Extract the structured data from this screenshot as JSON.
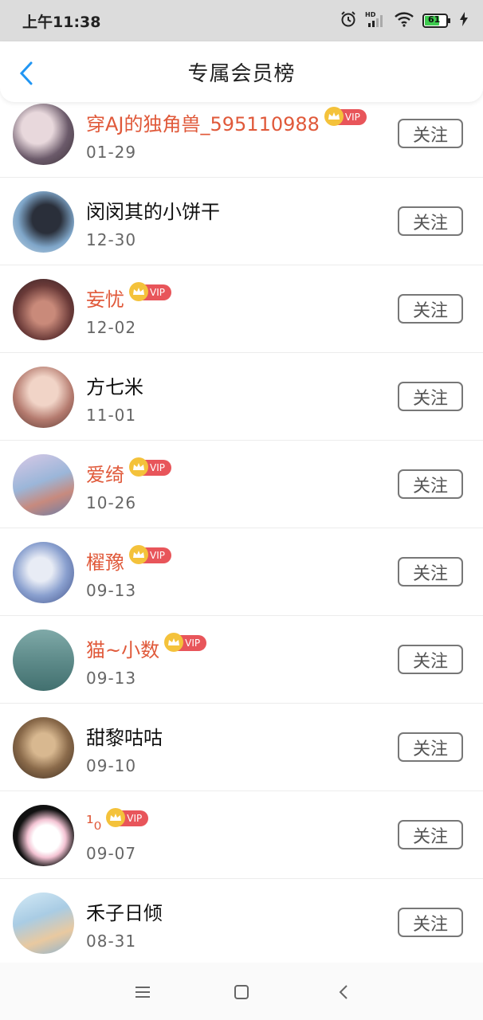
{
  "status_bar": {
    "time": "上午11:38",
    "battery": "61",
    "icons": [
      "alarm-icon",
      "signal-hd-icon",
      "wifi-icon",
      "battery-icon",
      "charging-icon"
    ]
  },
  "header": {
    "title": "专属会员榜",
    "back_icon": "chevron-left-icon"
  },
  "colors": {
    "accent": "#2196f3",
    "vip_name": "#e0593a",
    "vip_badge": "#e8555a",
    "crown": "#f4c23b"
  },
  "vip_label": "VIP",
  "follow_label": "关注",
  "members": [
    {
      "name": "穿AJ的独角兽_595110988",
      "date": "01-29",
      "vip": true
    },
    {
      "name": "闵闵其的小饼干",
      "date": "12-30",
      "vip": false
    },
    {
      "name": "妄忧",
      "date": "12-02",
      "vip": true
    },
    {
      "name": "方七米",
      "date": "11-01",
      "vip": false
    },
    {
      "name": "爱绮",
      "date": "10-26",
      "vip": true
    },
    {
      "name": "櫂豫",
      "date": "09-13",
      "vip": true
    },
    {
      "name": "猫~小数",
      "date": "09-13",
      "vip": true
    },
    {
      "name": "甜黎咕咕",
      "date": "09-10",
      "vip": false
    },
    {
      "name": "¹₀",
      "date": "09-07",
      "vip": true
    },
    {
      "name": "禾子日倾",
      "date": "08-31",
      "vip": false
    }
  ],
  "nav": [
    "menu-icon",
    "home-square-icon",
    "back-triangle-icon"
  ]
}
